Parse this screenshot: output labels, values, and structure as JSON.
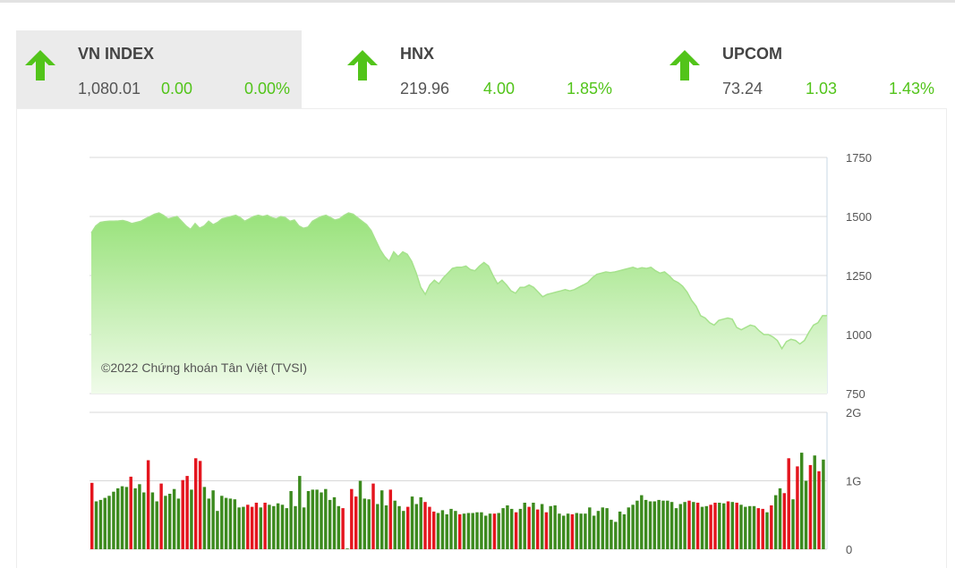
{
  "tickers": [
    {
      "name": "VN INDEX",
      "value": "1,080.01",
      "change": "0.00",
      "pct": "0.00%"
    },
    {
      "name": "HNX",
      "value": "219.96",
      "change": "4.00",
      "pct": "1.85%"
    },
    {
      "name": "UPCOM",
      "value": "73.24",
      "change": "1.03",
      "pct": "1.43%"
    }
  ],
  "colors": {
    "up": "#52c41a",
    "down": "#e4151e",
    "vol_up": "#3c8a1e",
    "line": "#a6e28d",
    "fill_top": "#98e27a",
    "fill_bottom": "#eefbe8"
  },
  "chart_data": [
    {
      "type": "area",
      "title": "",
      "watermark": "©2022 Chứng khoán Tân Việt (TVSI)",
      "yticks": [
        750,
        1000,
        1250,
        1500,
        1750
      ],
      "ytick_labels": [
        "750",
        "1000",
        "1250",
        "1500",
        "1750"
      ],
      "ylim": [
        750,
        1750
      ],
      "grid": true,
      "series": [
        {
          "values": [
            1430,
            1460,
            1475,
            1478,
            1480,
            1480,
            1481,
            1483,
            1478,
            1470,
            1475,
            1480,
            1490,
            1500,
            1510,
            1515,
            1505,
            1490,
            1495,
            1500,
            1480,
            1460,
            1445,
            1470,
            1450,
            1460,
            1480,
            1465,
            1475,
            1490,
            1495,
            1500,
            1505,
            1495,
            1480,
            1490,
            1500,
            1505,
            1500,
            1505,
            1495,
            1490,
            1500,
            1495,
            1480,
            1485,
            1460,
            1450,
            1455,
            1480,
            1490,
            1500,
            1505,
            1495,
            1485,
            1490,
            1505,
            1515,
            1510,
            1495,
            1480,
            1465,
            1440,
            1400,
            1360,
            1330,
            1310,
            1350,
            1330,
            1350,
            1340,
            1310,
            1260,
            1200,
            1170,
            1210,
            1230,
            1215,
            1240,
            1260,
            1280,
            1285,
            1285,
            1290,
            1275,
            1270,
            1290,
            1305,
            1290,
            1250,
            1215,
            1230,
            1210,
            1185,
            1175,
            1200,
            1200,
            1210,
            1200,
            1180,
            1160,
            1170,
            1175,
            1180,
            1185,
            1190,
            1185,
            1190,
            1200,
            1210,
            1220,
            1240,
            1255,
            1260,
            1265,
            1262,
            1265,
            1270,
            1275,
            1280,
            1285,
            1278,
            1283,
            1280,
            1285,
            1270,
            1260,
            1265,
            1250,
            1230,
            1220,
            1205,
            1180,
            1145,
            1120,
            1080,
            1070,
            1050,
            1040,
            1060,
            1065,
            1070,
            1065,
            1030,
            1020,
            1030,
            1040,
            1035,
            1015,
            1000,
            1000,
            990,
            975,
            940,
            970,
            980,
            975,
            960,
            975,
            1010,
            1040,
            1050,
            1080,
            1080
          ]
        }
      ]
    },
    {
      "type": "bar",
      "title": "",
      "yticks": [
        0,
        1,
        2
      ],
      "ytick_labels": [
        "0",
        "1G",
        "2G"
      ],
      "ylim": [
        0,
        2
      ],
      "grid": true,
      "series": [
        {
          "name": "volume",
          "values": [
            0.97,
            0.7,
            0.72,
            0.75,
            0.78,
            0.84,
            0.89,
            0.92,
            0.91,
            1.06,
            0.89,
            0.95,
            0.83,
            1.3,
            0.83,
            0.7,
            0.96,
            0.78,
            0.81,
            0.88,
            0.74,
            1.01,
            1.07,
            0.87,
            1.33,
            1.29,
            0.91,
            0.74,
            0.86,
            0.56,
            0.78,
            0.75,
            0.74,
            0.73,
            0.61,
            0.62,
            0.65,
            0.62,
            0.68,
            0.61,
            0.68,
            0.65,
            0.63,
            0.67,
            0.65,
            0.6,
            0.85,
            0.63,
            1.07,
            0.61,
            0.85,
            0.87,
            0.87,
            0.83,
            0.88,
            0.72,
            0.76,
            0.63,
            0.6,
            0.01,
            0.88,
            0.77,
            1.0,
            0.74,
            0.73,
            0.96,
            0.66,
            0.86,
            0.64,
            0.87,
            0.71,
            0.63,
            0.56,
            0.62,
            0.77,
            0.66,
            0.76,
            0.69,
            0.62,
            0.55,
            0.53,
            0.57,
            0.51,
            0.59,
            0.56,
            0.51,
            0.52,
            0.53,
            0.53,
            0.54,
            0.54,
            0.49,
            0.52,
            0.52,
            0.53,
            0.6,
            0.64,
            0.59,
            0.54,
            0.59,
            0.68,
            0.62,
            0.68,
            0.58,
            0.66,
            0.54,
            0.63,
            0.64,
            0.52,
            0.49,
            0.52,
            0.51,
            0.53,
            0.52,
            0.52,
            0.61,
            0.49,
            0.56,
            0.61,
            0.6,
            0.43,
            0.4,
            0.55,
            0.51,
            0.61,
            0.65,
            0.71,
            0.79,
            0.72,
            0.7,
            0.7,
            0.72,
            0.71,
            0.71,
            0.69,
            0.6,
            0.66,
            0.69,
            0.71,
            0.69,
            0.68,
            0.62,
            0.63,
            0.65,
            0.68,
            0.68,
            0.67,
            0.7,
            0.69,
            0.68,
            0.65,
            0.62,
            0.63,
            0.63,
            0.6,
            0.59,
            0.54,
            0.64,
            0.79,
            0.89,
            0.82,
            1.33,
            0.73,
            1.21,
            1.41,
            1.0,
            1.23,
            1.37,
            1.14,
            1.31
          ]
        }
      ],
      "bar_colors": [
        "r",
        "g",
        "g",
        "g",
        "g",
        "g",
        "g",
        "g",
        "g",
        "r",
        "g",
        "g",
        "g",
        "r",
        "g",
        "g",
        "r",
        "g",
        "g",
        "g",
        "g",
        "r",
        "r",
        "g",
        "r",
        "r",
        "g",
        "g",
        "g",
        "g",
        "g",
        "g",
        "g",
        "g",
        "g",
        "g",
        "r",
        "r",
        "r",
        "g",
        "r",
        "g",
        "g",
        "g",
        "g",
        "g",
        "g",
        "g",
        "g",
        "g",
        "g",
        "g",
        "g",
        "g",
        "g",
        "g",
        "g",
        "g",
        "r",
        "g",
        "r",
        "r",
        "g",
        "g",
        "g",
        "r",
        "g",
        "g",
        "g",
        "r",
        "g",
        "g",
        "g",
        "r",
        "g",
        "g",
        "g",
        "r",
        "r",
        "r",
        "g",
        "g",
        "g",
        "g",
        "g",
        "r",
        "g",
        "g",
        "g",
        "g",
        "g",
        "g",
        "g",
        "r",
        "g",
        "g",
        "g",
        "g",
        "r",
        "g",
        "g",
        "r",
        "g",
        "r",
        "g",
        "r",
        "g",
        "g",
        "g",
        "g",
        "g",
        "r",
        "g",
        "g",
        "g",
        "g",
        "g",
        "g",
        "g",
        "g",
        "g",
        "g",
        "g",
        "g",
        "g",
        "g",
        "g",
        "g",
        "g",
        "g",
        "g",
        "g",
        "g",
        "g",
        "g",
        "g",
        "g",
        "g",
        "r",
        "g",
        "r",
        "g",
        "g",
        "r",
        "r",
        "g",
        "g",
        "r",
        "g",
        "r",
        "g",
        "g",
        "g",
        "g",
        "r",
        "r",
        "g",
        "r",
        "g",
        "g",
        "r",
        "r",
        "g",
        "r",
        "g",
        "g",
        "r",
        "g",
        "r",
        "g",
        "g",
        "g",
        "r",
        "g"
      ]
    }
  ]
}
